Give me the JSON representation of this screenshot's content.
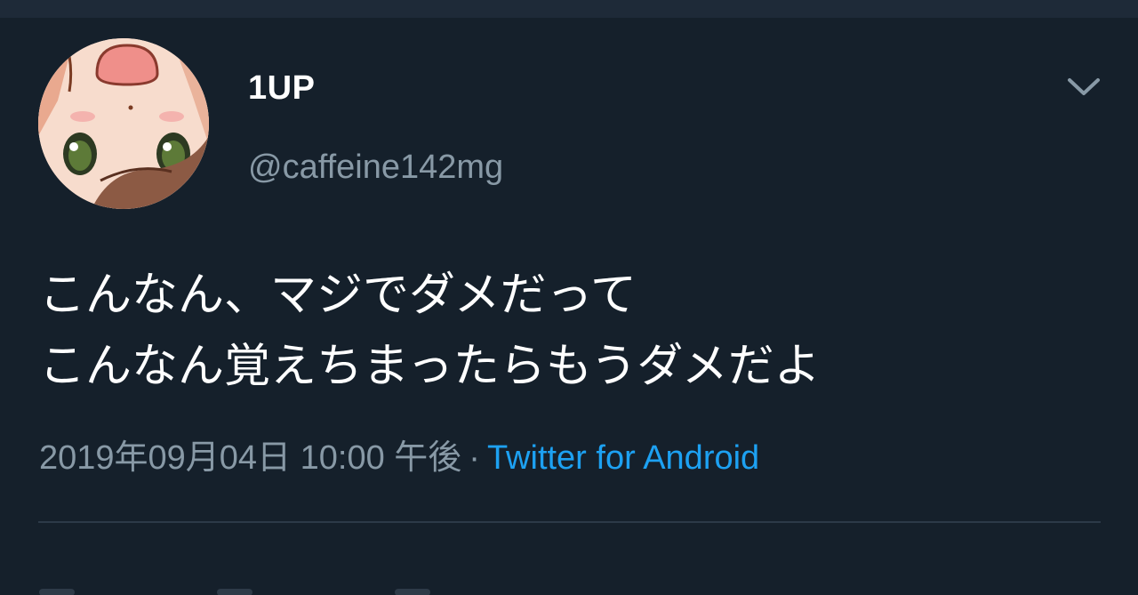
{
  "tweet": {
    "display_name": "1UP",
    "handle": "@caffeine142mg",
    "text_lines": [
      "こんなん、マジでダメだって",
      "こんなん覚えちまったらもうダメだよ"
    ],
    "timestamp": "2019年09月04日 10:00 午後",
    "separator": "·",
    "source": "Twitter for Android",
    "menu_icon": "chevron-down-icon",
    "avatar_icon": "avatar-anime-character"
  },
  "colors": {
    "background": "#15202b",
    "text": "#ffffff",
    "secondary": "#8899a6",
    "link": "#1da1f2",
    "divider": "#2c3a48"
  }
}
